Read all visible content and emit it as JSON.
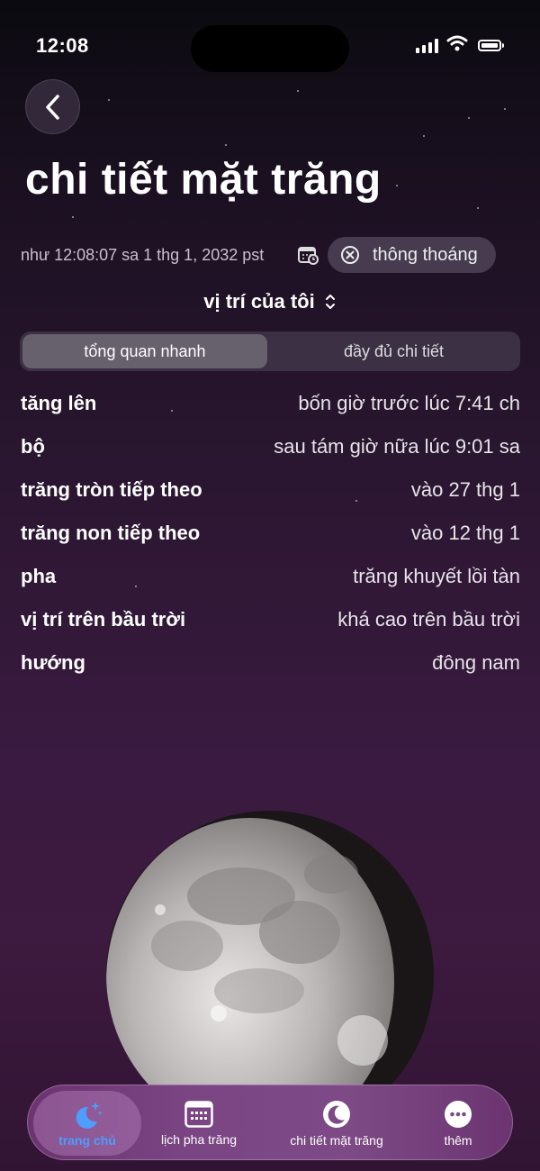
{
  "status_bar": {
    "time": "12:08"
  },
  "page": {
    "title": "chi tiết mặt trăng",
    "date_text": "như 12:08:07 sa 1 thg 1, 2032 pst",
    "clear_button_label": "thông thoáng",
    "location_label": "vị trí của tôi"
  },
  "segments": {
    "overview": "tổng quan nhanh",
    "full": "đầy đủ chi tiết",
    "selected": "tổng quan nhanh"
  },
  "details": [
    {
      "label": "tăng lên",
      "value": "bốn giờ trước lúc 7:41 ch"
    },
    {
      "label": "bộ",
      "value": "sau tám giờ nữa lúc 9:01 sa"
    },
    {
      "label": "trăng tròn tiếp theo",
      "value": "vào 27 thg 1"
    },
    {
      "label": "trăng non tiếp theo",
      "value": "vào 12 thg 1"
    },
    {
      "label": "pha",
      "value": "trăng khuyết lồi tàn"
    },
    {
      "label": "vị trí trên bầu trời",
      "value": "khá cao trên bầu trời"
    },
    {
      "label": "hướng",
      "value": "đông nam"
    }
  ],
  "tabs": [
    {
      "label": "trang chủ",
      "icon": "moon-stars-icon",
      "active": true
    },
    {
      "label": "lịch pha trăng",
      "icon": "calendar-icon"
    },
    {
      "label": "chi tiết mặt trăng",
      "icon": "moon-icon"
    },
    {
      "label": "thêm",
      "icon": "ellipsis-icon"
    }
  ],
  "colors": {
    "accent": "#4f9dff",
    "tab_bar": "#7b4584"
  }
}
